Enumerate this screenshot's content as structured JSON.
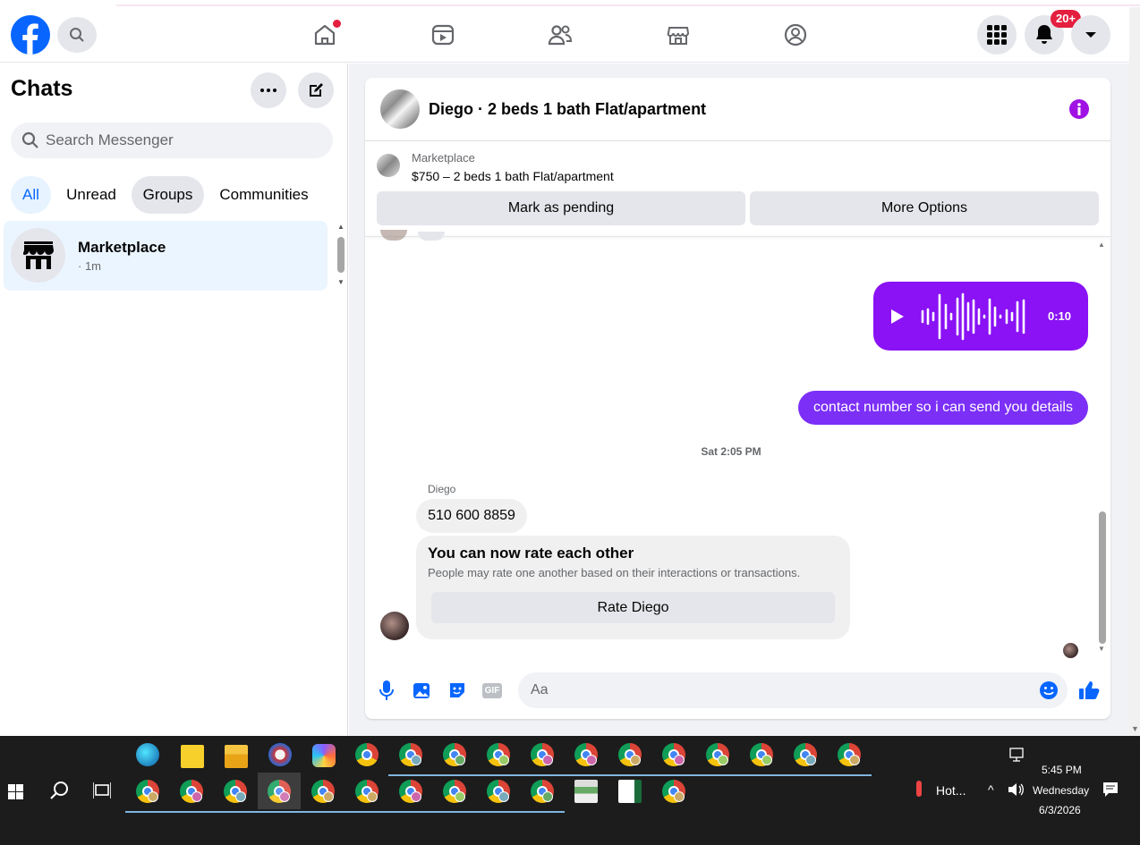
{
  "nav": {
    "notif_badge": "20+"
  },
  "left": {
    "title": "Chats",
    "search_placeholder": "Search Messenger",
    "filters": [
      "All",
      "Unread",
      "Groups",
      "Communities"
    ],
    "chat_item": {
      "name": "Marketplace",
      "time": "· 1m"
    }
  },
  "chat": {
    "header_title": "Diego · 2 beds 1 bath Flat/apartment",
    "listing_source": "Marketplace",
    "listing_title": "$750 – 2 beds 1 bath Flat/apartment",
    "mark_pending": "Mark as pending",
    "more_options": "More Options",
    "voice_duration": "0:10",
    "sent_message": "contact number so i can send you details",
    "timestamp": "Sat 2:05 PM",
    "sender_name": "Diego",
    "received_message": "510 600 8859",
    "rate_title": "You can now rate each other",
    "rate_desc": "People may rate one another based on their interactions or transactions.",
    "rate_button": "Rate Diego",
    "composer_placeholder": "Aa",
    "gif_label": "GIF"
  },
  "taskbar": {
    "weather": "Hot...",
    "time": "5:45 PM",
    "day": "Wednesday",
    "date": "6/3/2026"
  },
  "colors": {
    "fb_blue": "#0866ff",
    "message_purple": "#7b2ff7",
    "voice_purple": "#8a12f5",
    "badge_red": "#e41e3f"
  }
}
